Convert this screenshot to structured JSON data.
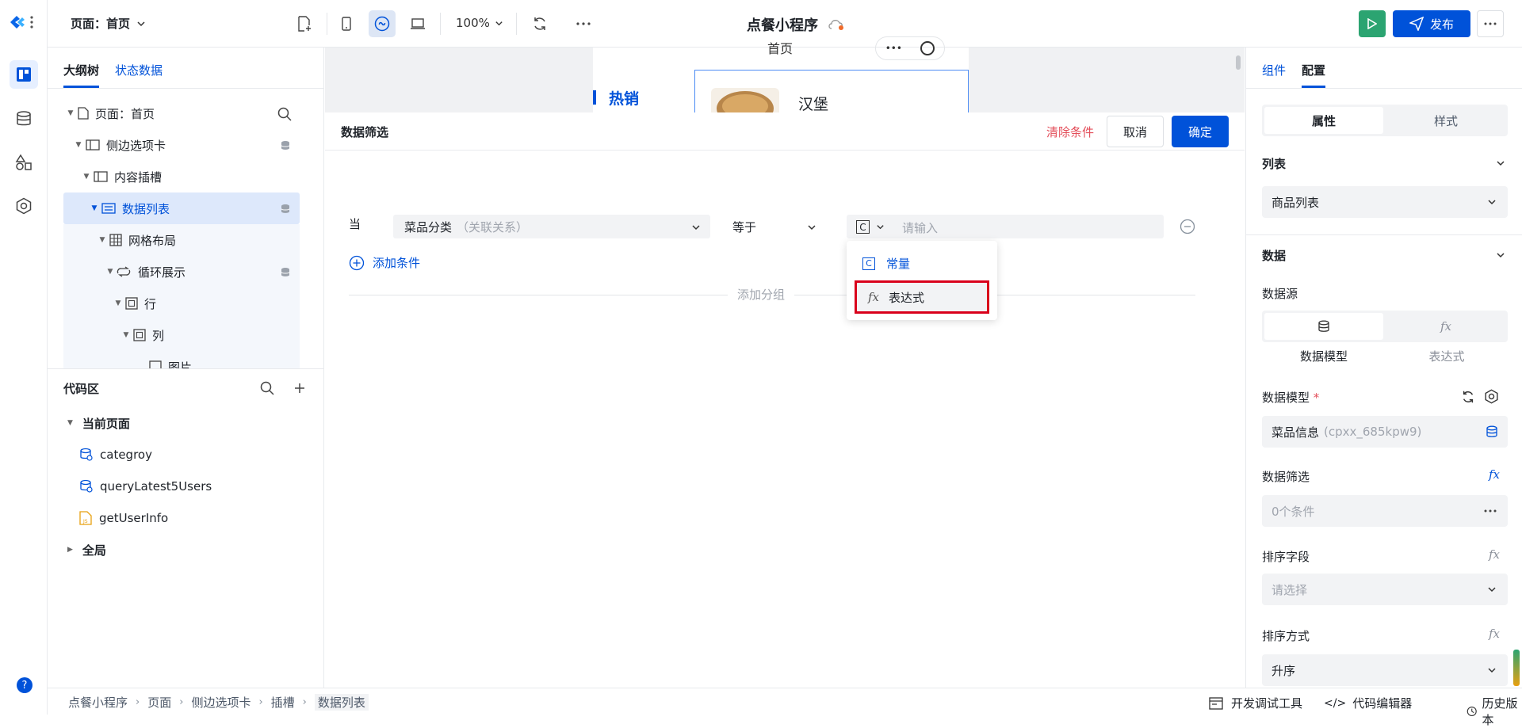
{
  "topbar": {
    "page_selector": "页面：首页",
    "zoom": "100%",
    "app_title": "点餐小程序",
    "publish_label": "发布"
  },
  "left_panel": {
    "tabs": [
      "大纲树",
      "状态数据"
    ],
    "tree": [
      {
        "label": "页面：首页"
      },
      {
        "label": "侧边选项卡"
      },
      {
        "label": "内容插槽"
      },
      {
        "label": "数据列表"
      },
      {
        "label": "网格布局"
      },
      {
        "label": "循环展示"
      },
      {
        "label": "行"
      },
      {
        "label": "列"
      },
      {
        "label": "图片"
      }
    ]
  },
  "code_area": {
    "title": "代码区",
    "current_page_label": "当前页面",
    "items": [
      "categroy",
      "queryLatest5Users",
      "getUserInfo"
    ],
    "global_label": "全局"
  },
  "preview": {
    "page_heading": "首页",
    "category": "热销",
    "product": "汉堡"
  },
  "filter_dialog": {
    "title": "数据筛选",
    "clear_label": "清除条件",
    "cancel_label": "取消",
    "confirm_label": "确定",
    "when_label": "当",
    "field_value": "菜品分类",
    "field_hint": "（关联关系）",
    "operator_value": "等于",
    "value_type_icon": "C",
    "value_placeholder": "请输入",
    "add_condition_label": "添加条件",
    "add_group_label": "添加分组",
    "dropdown_options": [
      "常量",
      "表达式"
    ]
  },
  "right_panel": {
    "tabs": [
      "组件",
      "配置"
    ],
    "segment": [
      "属性",
      "样式"
    ],
    "list_section": "列表",
    "list_value": "商品列表",
    "data_section": "数据",
    "data_source_label": "数据源",
    "data_source_options": [
      "数据模型",
      "表达式"
    ],
    "data_model_label": "数据模型",
    "required_mark": "*",
    "data_model_value": "菜品信息",
    "data_model_id": "(cpxx_685kpw9)",
    "filter_label": "数据筛选",
    "filter_value": "0个条件",
    "sort_field_label": "排序字段",
    "sort_field_placeholder": "请选择",
    "sort_order_label": "排序方式",
    "sort_order_value": "升序"
  },
  "bottom_bar": {
    "breadcrumb": [
      "点餐小程序",
      "页面",
      "侧边选项卡",
      "插槽",
      "数据列表"
    ],
    "dev_tools_label": "开发调试工具",
    "code_editor_label": "代码编辑器",
    "history_label": "历史版本"
  },
  "colors": {
    "primary": "#0052d9",
    "run_green": "#2ba471",
    "danger": "#e34d59",
    "highlight_box": "#d9001b"
  }
}
